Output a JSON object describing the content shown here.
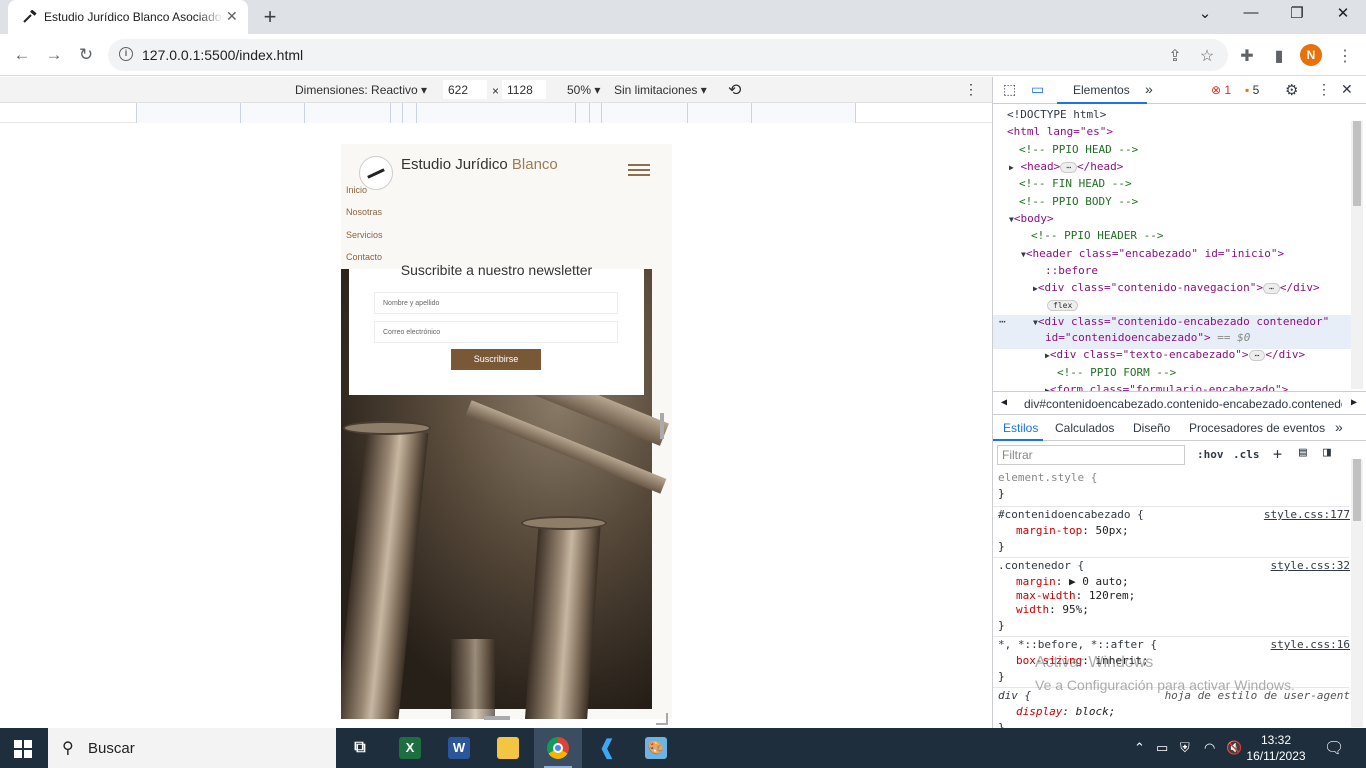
{
  "browser": {
    "tab_title": "Estudio Jurídico Blanco Asociados",
    "url": "127.0.0.1:5500/index.html",
    "avatar_letter": "N",
    "new_tab": "+",
    "close_tab": "✕"
  },
  "device_toolbar": {
    "dimensions_label": "Dimensiones: Reactivo",
    "width": "622",
    "times": "×",
    "height": "1128",
    "zoom": "50%",
    "throttle": "Sin limitaciones"
  },
  "site": {
    "brand_main": "Estudio Jurídico",
    "brand_accent": "Blanco",
    "nav": [
      "Inicio",
      "Nosotras",
      "Servicios",
      "Contacto"
    ],
    "newsletter_title": "Suscribite a nuestro newsletter",
    "name_placeholder": "Nombre y apellido",
    "email_placeholder": "Correo electrónico",
    "subscribe_label": "Suscribirse"
  },
  "devtools": {
    "tab_elements": "Elementos",
    "more_tabs": "»",
    "errors": "1",
    "warnings": "5",
    "dom": {
      "doctype": "<!DOCTYPE html>",
      "html_open": "<html lang=\"es\">",
      "c_ppio_head": "<!-- PPIO HEAD -->",
      "head": "<head>",
      "head_close": "</head>",
      "c_fin_head": "<!-- FIN HEAD -->",
      "c_ppio_body": "<!-- PPIO BODY -->",
      "body": "<body>",
      "c_ppio_header": "<!-- PPIO HEADER -->",
      "header_open": "<header class=\"encabezado\" id=\"inicio\">",
      "before": "::before",
      "div_nav": "<div class=\"contenido-navegacion\">",
      "div_close": "</div>",
      "flex": "flex",
      "div_enc_1": "<div class=\"contenido-encabezado contenedor\"",
      "div_enc_2": "id=\"contenidoencabezado\">",
      "eq": "== $0",
      "div_texto": "<div class=\"texto-encabezado\">",
      "c_ppio_form": "<!-- PPIO FORM -->",
      "form_partial": "<form class=\"formulario-encabezado\">"
    },
    "breadcrumb": "div#contenidoencabezado.contenido-encabezado.contenedor",
    "style_tabs": [
      "Estilos",
      "Calculados",
      "Diseño",
      "Procesadores de eventos"
    ],
    "filter_placeholder": "Filtrar",
    "hov": ":hov",
    "cls": ".cls",
    "rules": [
      {
        "selector": "element.style {",
        "source": "",
        "decls": [],
        "close": "}"
      },
      {
        "selector": "#contenidoencabezado {",
        "source": "style.css:177",
        "decls": [
          {
            "p": "margin-top",
            "v": "50px;"
          }
        ],
        "close": "}"
      },
      {
        "selector": ".contenedor {",
        "source": "style.css:32",
        "decls": [
          {
            "p": "margin",
            "v": "▶ 0 auto;"
          },
          {
            "p": "max-width",
            "v": "120rem;"
          },
          {
            "p": "width",
            "v": "95%;"
          }
        ],
        "close": "}"
      },
      {
        "selector": "*, *::before, *::after {",
        "source": "style.css:16",
        "decls": [
          {
            "p": "box-sizing",
            "v": "inherit;"
          }
        ],
        "close": "}"
      },
      {
        "selector": "div {",
        "source": "hoja de estilo de user-agent",
        "decls": [
          {
            "p": "display",
            "v": "block;"
          }
        ],
        "close": "}"
      }
    ]
  },
  "watermark": {
    "line1": "Activar Windows",
    "line2": "Ve a Configuración para activar Windows."
  },
  "taskbar": {
    "search_label": "Buscar",
    "time": "13:32",
    "date": "16/11/2023"
  }
}
